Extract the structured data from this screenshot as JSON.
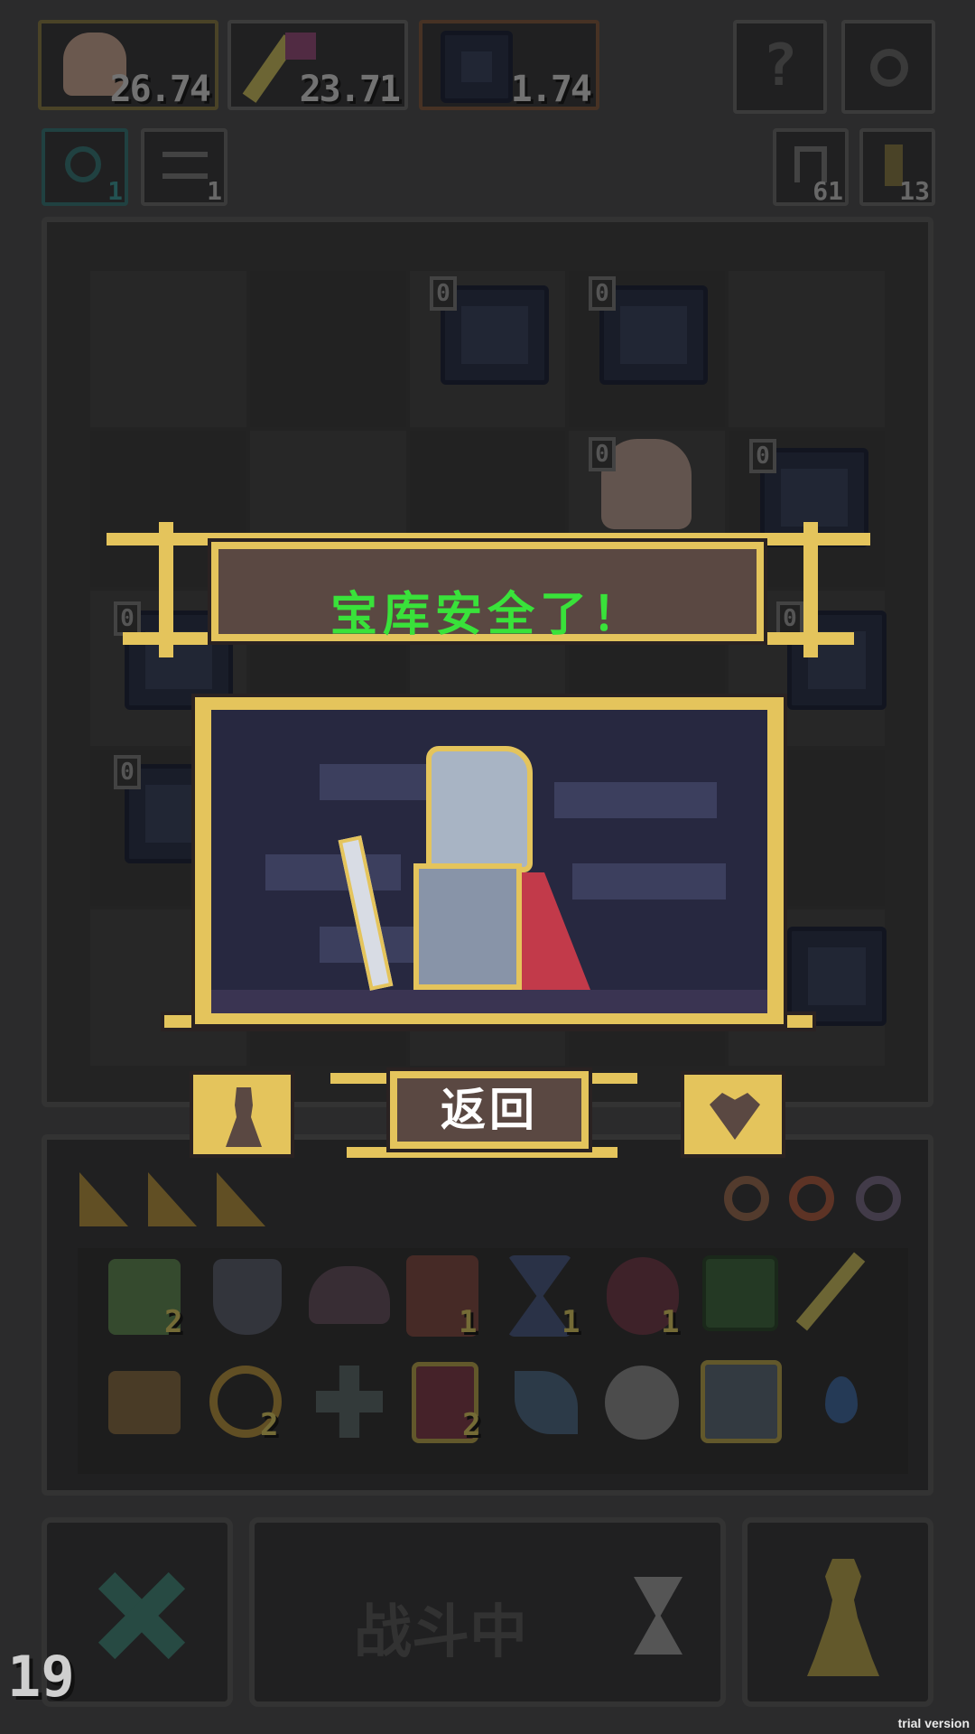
{
  "resources": [
    {
      "name": "hero",
      "value": "26.74",
      "color": "#8a7a3a"
    },
    {
      "name": "key-staff",
      "value": "23.71",
      "color": "#8a7a3a"
    },
    {
      "name": "vault",
      "value": "1.74",
      "color": "#8a5a3a"
    }
  ],
  "top_right": {
    "help_label": "?",
    "refresh_count": "61",
    "key_count": "13"
  },
  "top_left_small": {
    "clock_count": "1",
    "swap_count": "1"
  },
  "board": {
    "vault_tags": [
      "0",
      "0",
      "0",
      "0",
      "0",
      "0",
      "0"
    ]
  },
  "dialog": {
    "title": "宝库安全了！",
    "return_label": "返回"
  },
  "inventory": {
    "counts_row1": [
      "2",
      "1",
      "1",
      "1"
    ],
    "counts_row2": [
      "2",
      "2"
    ]
  },
  "bottom": {
    "battle_label": "战斗中",
    "turn_number": "19"
  },
  "watermark": "trial version",
  "colors": {
    "gold": "#e4c45c",
    "title_green": "#39e23a",
    "panel_brown": "#5a4842"
  }
}
